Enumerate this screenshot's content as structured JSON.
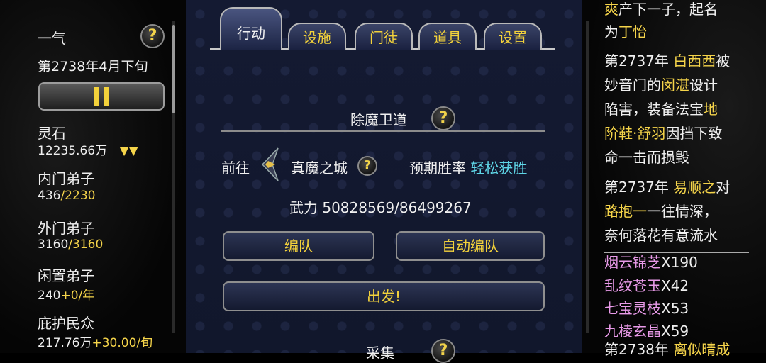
{
  "left": {
    "sect_name": "一气",
    "date": "第2738年4月下旬",
    "help_glyph": "?",
    "stats": {
      "spirit_stone_label": "灵石",
      "spirit_stone_value": "12235.66万",
      "spirit_stone_arrows": "▼▼",
      "inner_label": "内门弟子",
      "inner_current": "436",
      "inner_max": "/2230",
      "outer_label": "外门弟子",
      "outer_current": "3160",
      "outer_max": "/3160",
      "idle_label": "闲置弟子",
      "idle_value": "240",
      "idle_rate": "+0/年",
      "protect_label": "庇护民众",
      "protect_value": "217.76万",
      "protect_rate": "+30.00/旬"
    }
  },
  "tabs": [
    {
      "label": "行动",
      "active": true
    },
    {
      "label": "设施",
      "active": false
    },
    {
      "label": "门徒",
      "active": false
    },
    {
      "label": "道具",
      "active": false
    },
    {
      "label": "设置",
      "active": false
    }
  ],
  "mission": {
    "title": "除魔卫道",
    "goto_label": "前往",
    "destination": "真魔之城",
    "win_rate_label": "预期胜率",
    "win_rate_value": "轻松获胜",
    "power_label": "武力",
    "power_value": "50828569/86499267",
    "formation_button": "编队",
    "auto_formation_button": "自动编队",
    "depart_button": "出发!",
    "next_section": "采集"
  },
  "log": {
    "l1_gold": "爽",
    "l1_text": "产下一子，起名",
    "l2_text": "为",
    "l2_gold": "丁怡",
    "e1_year": "第2737年",
    "e1_name": "白西西",
    "e1_a": "被",
    "e1_b": "妙音门的",
    "e1_name2": "闵湛",
    "e1_c": "设计",
    "e1_d": "陷害，装备法宝",
    "e1_item1": "地",
    "e1_item2": "阶鞋·舒羽",
    "e1_e": "因挡下致",
    "e1_f": "命一击而损毁",
    "e2_year": "第2737年",
    "e2_name": "易顺之",
    "e2_a": "对",
    "e2_name2": "路抱一",
    "e2_b": "一往情深，",
    "e2_c": "奈何落花有意流水"
  },
  "inventory": [
    {
      "name": "烟云锦芝",
      "count": "X190",
      "color": "#e89ae8"
    },
    {
      "name": "乱纹苍玉",
      "count": "X42",
      "color": "#e89ae8"
    },
    {
      "name": "七宝灵枝",
      "count": "X53",
      "color": "#e89ae8"
    },
    {
      "name": "九棱玄晶",
      "count": "X59",
      "color": "#e89ae8"
    }
  ],
  "log_tail": {
    "year": "第2738年",
    "name": "离似晴成"
  }
}
